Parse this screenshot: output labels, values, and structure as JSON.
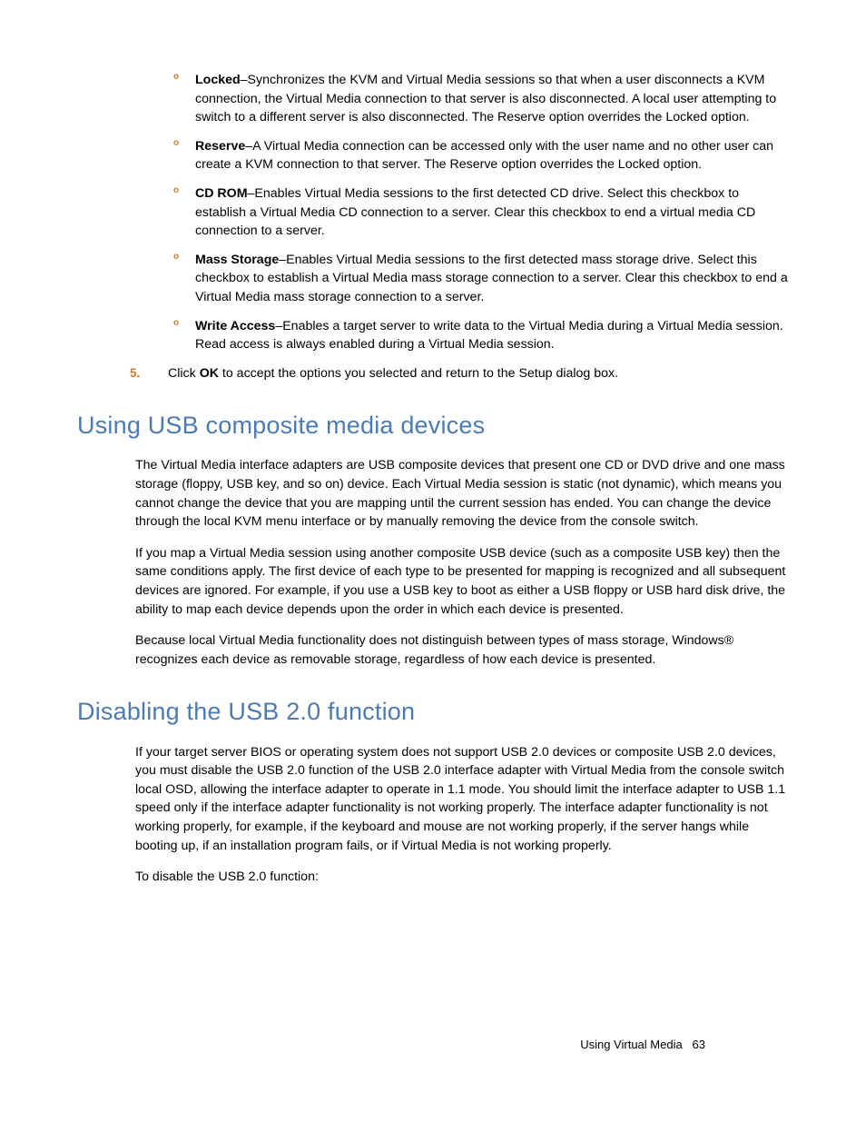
{
  "subItems": [
    {
      "term": "Locked",
      "text": "–Synchronizes the KVM and Virtual Media sessions so that when a user disconnects a KVM connection, the Virtual Media connection to that server is also disconnected. A local user attempting to switch to a different server is also disconnected. The Reserve option overrides the Locked option."
    },
    {
      "term": "Reserve",
      "text": "–A Virtual Media connection can be accessed only with the user name and no other user can create a KVM connection to that server. The Reserve option overrides the Locked option."
    },
    {
      "term": "CD ROM",
      "text": "–Enables Virtual Media sessions to the first detected CD drive. Select this checkbox to establish a Virtual Media CD connection to a server. Clear this checkbox to end a virtual media CD connection to a server."
    },
    {
      "term": "Mass Storage",
      "text": "–Enables Virtual Media sessions to the first detected mass storage drive. Select this checkbox to establish a Virtual Media mass storage connection to a server. Clear this checkbox to end a Virtual Media mass storage connection to a server."
    },
    {
      "term": "Write Access",
      "text": "–Enables a target server to write data to the Virtual Media during a Virtual Media session. Read access is always enabled during a Virtual Media session."
    }
  ],
  "step5": {
    "num": "5.",
    "pre": "Click ",
    "bold": "OK",
    "post": " to accept the options you selected and return to the Setup dialog box."
  },
  "h1": "Using USB composite media devices",
  "p1": "The Virtual Media interface adapters are USB composite devices that present one CD or DVD drive and one mass storage (floppy, USB key, and so on) device. Each Virtual Media session is static (not dynamic), which means you cannot change the device that you are mapping until the current session has ended. You can change the device through the local KVM menu interface or by manually removing the device from the console switch.",
  "p2": "If you map a Virtual Media session using another composite USB device (such as a composite USB key) then the same conditions apply. The first device of each type to be presented for mapping is recognized and all subsequent devices are ignored. For example, if you use a USB key to boot as either a USB floppy or USB hard disk drive, the ability to map each device depends upon the order in which each device is presented.",
  "p3": "Because local Virtual Media functionality does not distinguish between types of mass storage, Windows® recognizes each device as removable storage, regardless of how each device is presented.",
  "h2": "Disabling the USB 2.0 function",
  "p4": "If your target server BIOS or operating system does not support USB 2.0 devices or composite USB 2.0 devices, you must disable the USB 2.0 function of the USB 2.0 interface adapter with Virtual Media from the console switch local OSD, allowing the interface adapter to operate in 1.1 mode. You should limit the interface adapter to USB 1.1 speed only if the interface adapter functionality is not working properly. The interface adapter functionality is not working properly, for example, if the keyboard and mouse are not working properly, if the server hangs while booting up, if an installation program fails, or if Virtual Media is not working properly.",
  "p5": "To disable the USB 2.0 function:",
  "footer": {
    "section": "Using Virtual Media",
    "page": "63"
  }
}
